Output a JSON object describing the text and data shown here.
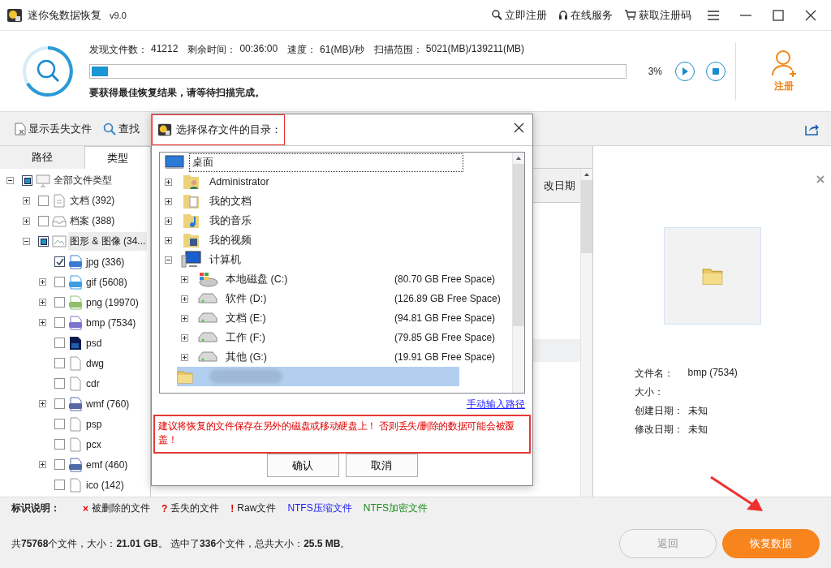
{
  "window": {
    "title": "迷你兔数据恢复",
    "version": "v9.0",
    "actions": [
      {
        "kind": "register",
        "label": "立即注册"
      },
      {
        "kind": "service",
        "label": "在线服务"
      },
      {
        "kind": "code",
        "label": "获取注册码"
      }
    ]
  },
  "scan": {
    "stats": [
      {
        "label": "发现文件数：",
        "value": "41212"
      },
      {
        "label": "剩余时间：",
        "value": "00:36:00"
      },
      {
        "label": "速度：",
        "value": "61(MB)/秒"
      },
      {
        "label": "扫描范围：",
        "value": "5021(MB)/139211(MB)"
      }
    ],
    "level": 0.03,
    "percent": "3%",
    "hint": "要获得最佳恢复结果，请等待扫描完成。",
    "register": "注册"
  },
  "toolbar": [
    {
      "kind": "lost",
      "label": "显示丢失文件"
    },
    {
      "kind": "search",
      "label": "查找"
    }
  ],
  "side_tabs": [
    {
      "label": "路径",
      "selected": false
    },
    {
      "label": "类型",
      "selected": true
    }
  ],
  "type_tree": {
    "label": "全部文件类型",
    "kind": "monitor",
    "checked": true,
    "partial": true,
    "expanded": true,
    "selected": false,
    "children": [
      {
        "label": "文档 (392)",
        "kind": "doc",
        "checked": false,
        "partial": false,
        "expanded": false,
        "selected": false
      },
      {
        "label": "档案 (388)",
        "kind": "archive",
        "checked": false,
        "partial": false,
        "expanded": false,
        "selected": false
      },
      {
        "label": "图形 & 图像 (34...",
        "kind": "image",
        "checked": true,
        "partial": true,
        "expanded": true,
        "selected": true,
        "children": [
          {
            "label": "jpg (336)",
            "kind": "badge",
            "color": "#3b7bd4",
            "checked": true,
            "partial": false,
            "selected": false
          },
          {
            "label": "gif (5608)",
            "kind": "badge",
            "color": "#3d9ee6",
            "checked": false,
            "partial": false,
            "expanded": false,
            "selected": false
          },
          {
            "label": "png (19970)",
            "kind": "badge",
            "color": "#8fbf6a",
            "checked": false,
            "partial": false,
            "expanded": false,
            "selected": false
          },
          {
            "label": "bmp (7534)",
            "kind": "badge",
            "color": "#7a74cc",
            "checked": false,
            "partial": false,
            "expanded": false,
            "selected": false
          },
          {
            "label": "psd",
            "kind": "ps",
            "checked": false,
            "partial": false,
            "selected": false
          },
          {
            "label": "dwg",
            "kind": "blank",
            "checked": false,
            "partial": false,
            "selected": false
          },
          {
            "label": "cdr",
            "kind": "blank",
            "checked": false,
            "partial": false,
            "selected": false
          },
          {
            "label": "wmf (760)",
            "kind": "badge",
            "color": "#5a68a8",
            "checked": false,
            "partial": false,
            "expanded": false,
            "selected": false
          },
          {
            "label": "psp",
            "kind": "blank",
            "checked": false,
            "partial": false,
            "selected": false
          },
          {
            "label": "pcx",
            "kind": "blank",
            "checked": false,
            "partial": false,
            "selected": false
          },
          {
            "label": "emf (460)",
            "kind": "badge",
            "color": "#4f6aa8",
            "checked": false,
            "partial": false,
            "expanded": false,
            "selected": false
          },
          {
            "label": "ico (142)",
            "kind": "blank",
            "checked": false,
            "partial": false,
            "selected": false
          }
        ]
      }
    ]
  },
  "file_list": {
    "column_partial": "改日期"
  },
  "preview": {
    "fields": [
      {
        "label": "文件名：",
        "value": "bmp (7534)"
      },
      {
        "label": "大小："
      },
      {
        "label": "创建日期：",
        "value": "未知"
      },
      {
        "label": "修改日期：",
        "value": "未知"
      }
    ]
  },
  "legend": {
    "title": "标识说明：",
    "items": [
      {
        "mark": "×",
        "label": "被删除的文件",
        "color": "#e00000"
      },
      {
        "mark": "?",
        "label": "丢失的文件",
        "color": "#e00000"
      },
      {
        "mark": "!",
        "label": "Raw文件",
        "color": "#e00000"
      },
      {
        "label": "NTFS压缩文件",
        "color": "#1a1aff"
      },
      {
        "label": "NTFS加密文件",
        "color": "#1a8a1a"
      }
    ]
  },
  "status": "共**75768**个文件，大小：**21.01 GB**。 选中了**336**个文件，总共大小：**25.5 MB**。",
  "buttons": [
    {
      "label": "返回",
      "disabled": true
    },
    {
      "label": "恢复数据",
      "disabled": false
    }
  ],
  "dialog": {
    "title": "选择保存文件的目录：",
    "tree": {
      "label": "桌面",
      "kind": "desktop",
      "focused": true,
      "children": [
        {
          "label": "Administrator",
          "kind": "user-folder",
          "expanded": false
        },
        {
          "label": "我的文档",
          "kind": "doc-folder",
          "expanded": false
        },
        {
          "label": "我的音乐",
          "kind": "music-folder",
          "expanded": false
        },
        {
          "label": "我的视频",
          "kind": "video-folder",
          "expanded": false
        },
        {
          "label": "计算机",
          "kind": "computer",
          "expanded": true,
          "children": [
            {
              "label": "本地磁盘 (C:)",
              "free": "(80.70 GB Free Space)",
              "kind": "system-drive",
              "expanded": false
            },
            {
              "label": "软件 (D:)",
              "free": "(126.89 GB Free Space)",
              "kind": "drive",
              "expanded": false
            },
            {
              "label": "文档 (E:)",
              "free": "(94.81 GB Free Space)",
              "kind": "drive",
              "expanded": false
            },
            {
              "label": "工作 (F:)",
              "free": "(79.85 GB Free Space)",
              "kind": "drive",
              "expanded": false
            },
            {
              "label": "其他 (G:)",
              "free": "(19.91 GB Free Space)",
              "kind": "drive",
              "expanded": false
            }
          ]
        },
        {
          "kind": "blurred-folder",
          "selected": true
        }
      ]
    },
    "link": "手动输入路径",
    "warning": "建议将恢复的文件保存在另外的磁盘或移动硬盘上！ 否则丢失/删除的数据可能会被覆盖！",
    "buttons": [
      "确认",
      "取消"
    ]
  }
}
